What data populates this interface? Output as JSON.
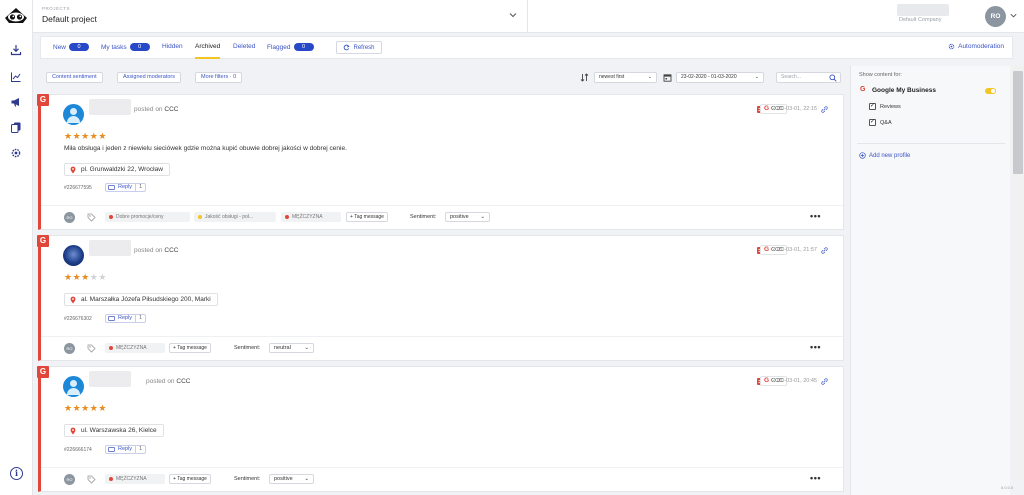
{
  "header": {
    "projects_label": "PROJECTS",
    "project_name": "Default project",
    "company": "Default Company",
    "user_initials": "RO"
  },
  "tabs": [
    {
      "label": "New",
      "count": "0"
    },
    {
      "label": "My tasks",
      "count": "0"
    },
    {
      "label": "Hidden"
    },
    {
      "label": "Archived"
    },
    {
      "label": "Deleted"
    },
    {
      "label": "Flagged",
      "count": "0"
    }
  ],
  "toolbar": {
    "refresh_label": "Refresh",
    "automoderation_label": "Automoderation"
  },
  "filters": {
    "content_sentiment": "Content sentiment",
    "assigned_moderators": "Assigned moderators",
    "more_filters": "More filters · 0",
    "sort_value": "newest first",
    "date_range": "23-02-2020 - 01-03-2020",
    "search_placeholder": "Search..."
  },
  "right_panel": {
    "title": "Show content for:",
    "profile_icon_letter": "G",
    "profile_name": "Google My Business",
    "options": [
      {
        "label": "Reviews",
        "checked": true
      },
      {
        "label": "Q&A",
        "checked": true
      }
    ],
    "add_profile": "Add new profile"
  },
  "reviews": [
    {
      "posted_prefix": "posted on",
      "posted_on": "CCC",
      "rating": 5,
      "text": "Miła obsługa i jeden z niewielu sieciówek gdzie można kupić obuwie dobrej jakości w dobrej cenie.",
      "location": "pl. Grunwaldzki 22, Wrocław",
      "id": "#226677595",
      "reply_label": "Reply",
      "reply_count": "1",
      "source": "CCC",
      "date": "2020-03-01, 22:15",
      "tags": [
        {
          "label": "Dobre promocje/ceny",
          "color": "#e0463a"
        },
        {
          "label": "Jakość obsługi - poł...",
          "color": "#f3c623"
        },
        {
          "label": "MĘŻCZYZNA",
          "color": "#e0463a"
        }
      ],
      "tag_message_label": "+ Tag message",
      "sentiment_label": "Sentiment:",
      "sentiment": "positive",
      "moderator_initials": "RO"
    },
    {
      "posted_prefix": "posted on",
      "posted_on": "CCC",
      "rating": 3,
      "text": "",
      "location": "al. Marszałka Józefa Piłsudskiego 200, Marki",
      "id": "#226676302",
      "reply_label": "Reply",
      "reply_count": "1",
      "source": "CCC",
      "date": "2020-03-01, 21:57",
      "tags": [
        {
          "label": "MĘŻCZYZNA",
          "color": "#e0463a"
        }
      ],
      "tag_message_label": "+ Tag message",
      "sentiment_label": "Sentiment:",
      "sentiment": "neutral",
      "moderator_initials": "RO"
    },
    {
      "posted_prefix": "posted on",
      "posted_on": "CCC",
      "rating": 5,
      "text": "",
      "location": "ul. Warszawska 26, Kielce",
      "id": "#226666174",
      "reply_label": "Reply",
      "reply_count": "1",
      "source": "CCC",
      "date": "2020-03-01, 20:45",
      "tags": [
        {
          "label": "MĘŻCZYZNA",
          "color": "#e0463a"
        }
      ],
      "tag_message_label": "+ Tag message",
      "sentiment_label": "Sentiment:",
      "sentiment": "positive",
      "moderator_initials": "RO"
    }
  ],
  "source_icon_letter": "G",
  "footer_tag": "0.0.0.0",
  "colors": {
    "accent_blue": "#2748c7",
    "google_red": "#e0463a",
    "star": "#e88b1c",
    "tab_underline": "#f3c623"
  }
}
